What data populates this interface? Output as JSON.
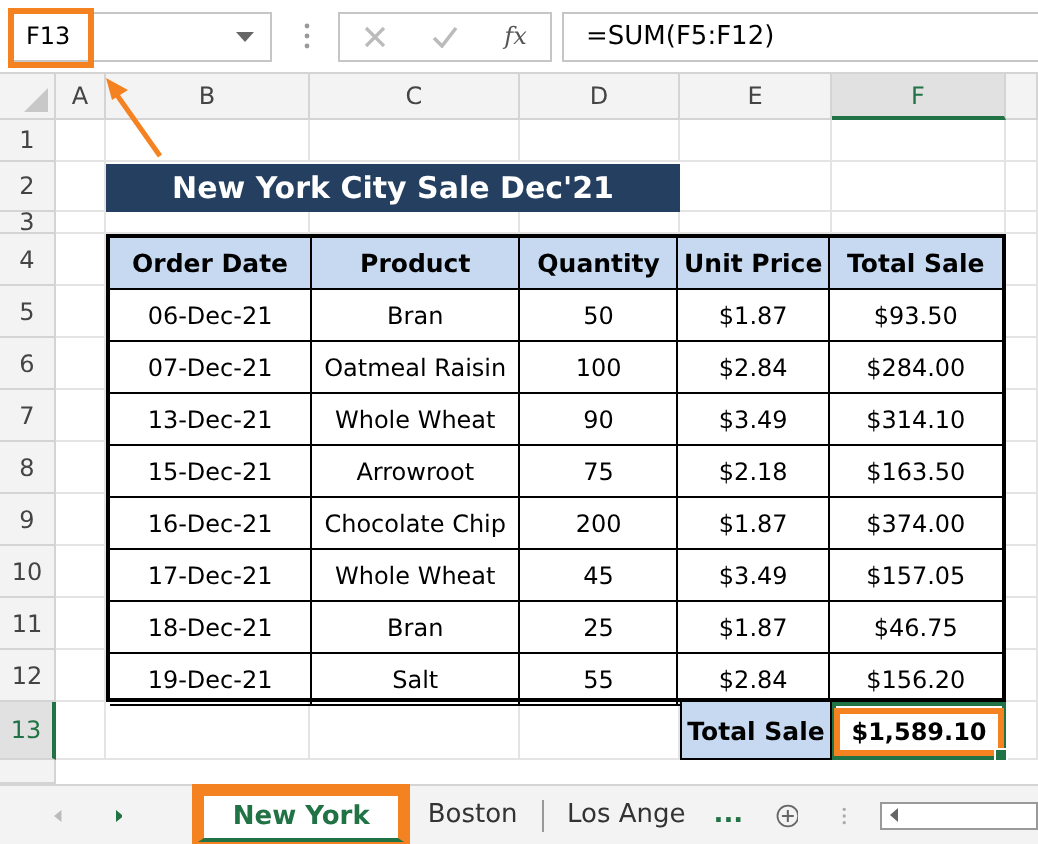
{
  "name_box": {
    "value": "F13",
    "highlighted": true
  },
  "fx_label": "fx",
  "formula": "=SUM(F5:F12)",
  "columns": [
    {
      "label": "A",
      "selected": false
    },
    {
      "label": "B",
      "selected": false
    },
    {
      "label": "C",
      "selected": false
    },
    {
      "label": "D",
      "selected": false
    },
    {
      "label": "E",
      "selected": false
    },
    {
      "label": "F",
      "selected": true
    }
  ],
  "rows": [
    {
      "label": "1",
      "selected": false
    },
    {
      "label": "2",
      "selected": false
    },
    {
      "label": "3",
      "selected": false
    },
    {
      "label": "4",
      "selected": false
    },
    {
      "label": "5",
      "selected": false
    },
    {
      "label": "6",
      "selected": false
    },
    {
      "label": "7",
      "selected": false
    },
    {
      "label": "8",
      "selected": false
    },
    {
      "label": "9",
      "selected": false
    },
    {
      "label": "10",
      "selected": false
    },
    {
      "label": "11",
      "selected": false
    },
    {
      "label": "12",
      "selected": false
    },
    {
      "label": "13",
      "selected": true
    }
  ],
  "title": "New York City Sale Dec'21",
  "table": {
    "columns": [
      "Order Date",
      "Product",
      "Quantity",
      "Unit Price",
      "Total Sale"
    ],
    "rows": [
      [
        "06-Dec-21",
        "Bran",
        "50",
        "$1.87",
        "$93.50"
      ],
      [
        "07-Dec-21",
        "Oatmeal Raisin",
        "100",
        "$2.84",
        "$284.00"
      ],
      [
        "13-Dec-21",
        "Whole Wheat",
        "90",
        "$3.49",
        "$314.10"
      ],
      [
        "15-Dec-21",
        "Arrowroot",
        "75",
        "$2.18",
        "$163.50"
      ],
      [
        "16-Dec-21",
        "Chocolate Chip",
        "200",
        "$1.87",
        "$374.00"
      ],
      [
        "17-Dec-21",
        "Whole Wheat",
        "45",
        "$3.49",
        "$157.05"
      ],
      [
        "18-Dec-21",
        "Bran",
        "25",
        "$1.87",
        "$46.75"
      ],
      [
        "19-Dec-21",
        "Salt",
        "55",
        "$2.84",
        "$156.20"
      ]
    ]
  },
  "total": {
    "label": "Total Sale",
    "value": "$1,589.10",
    "highlighted": true
  },
  "sheet_tabs": [
    {
      "label": "New York",
      "selected": true,
      "highlighted": true
    },
    {
      "label": "Boston",
      "selected": false,
      "highlighted": false
    },
    {
      "label": "Los Ange",
      "selected": false,
      "highlighted": false
    }
  ],
  "tabs_more": "..."
}
